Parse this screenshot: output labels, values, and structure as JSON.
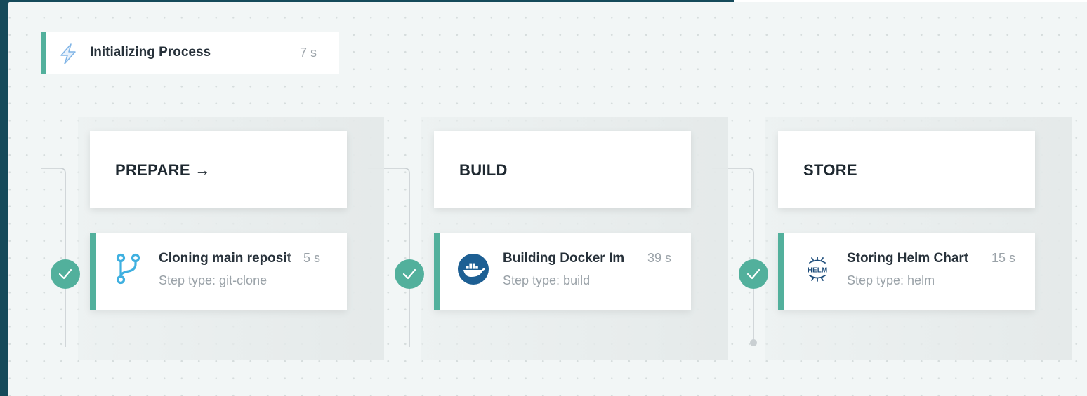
{
  "init_step": {
    "title": "Initializing Process",
    "duration": "7 s",
    "icon": "lightning-bolt-icon"
  },
  "stages": [
    {
      "title": "PREPARE →",
      "step": {
        "name": "Cloning main reposit",
        "duration": "5 s",
        "type": "Step type: git-clone",
        "icon": "git-branch-icon",
        "status": "success"
      }
    },
    {
      "title": "BUILD",
      "step": {
        "name": "Building Docker Im",
        "duration": "39 s",
        "type": "Step type: build",
        "icon": "docker-icon",
        "status": "success"
      }
    },
    {
      "title": "STORE",
      "step": {
        "name": "Storing Helm Chart",
        "duration": "15 s",
        "type": "Step type: helm",
        "icon": "helm-icon",
        "helm_label": "HELM",
        "status": "success"
      }
    }
  ],
  "colors": {
    "accent": "#52b09c",
    "frame": "#154a5a",
    "canvas": "#f2f6f6",
    "muted_text": "#9aa2a8",
    "text": "#27313a"
  }
}
